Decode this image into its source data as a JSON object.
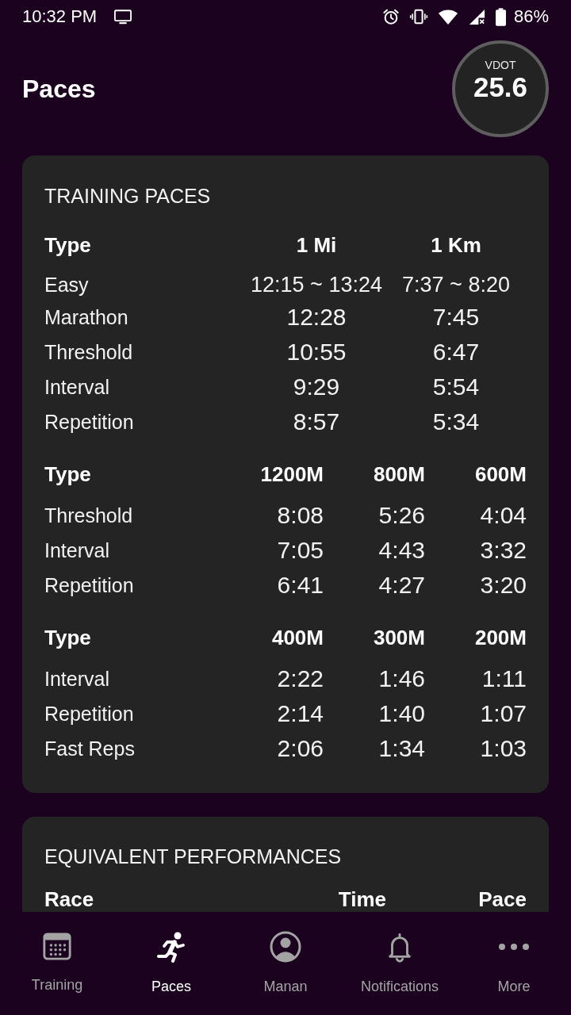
{
  "status_bar": {
    "time": "10:32 PM",
    "battery": "86%"
  },
  "header": {
    "title": "Paces",
    "vdot_label": "VDOT",
    "vdot_value": "25.6"
  },
  "training_paces": {
    "title": "TRAINING PACES",
    "tables": [
      {
        "kind": "distance",
        "columns": [
          "Type",
          "1 Mi",
          "1 Km"
        ],
        "rows": [
          {
            "kind": "range",
            "type": "Easy",
            "values": [
              "12:15 ~ 13:24",
              "7:37 ~ 8:20"
            ]
          },
          {
            "kind": "single",
            "type": "Marathon",
            "values": [
              "12:28",
              "7:45"
            ]
          },
          {
            "kind": "single",
            "type": "Threshold",
            "values": [
              "10:55",
              "6:47"
            ]
          },
          {
            "kind": "single",
            "type": "Interval",
            "values": [
              "9:29",
              "5:54"
            ]
          },
          {
            "kind": "single",
            "type": "Repetition",
            "values": [
              "8:57",
              "5:34"
            ]
          }
        ]
      },
      {
        "kind": "split",
        "columns": [
          "Type",
          "1200M",
          "800M",
          "600M"
        ],
        "rows": [
          {
            "kind": "single",
            "type": "Threshold",
            "values": [
              "8:08",
              "5:26",
              "4:04"
            ]
          },
          {
            "kind": "single",
            "type": "Interval",
            "values": [
              "7:05",
              "4:43",
              "3:32"
            ]
          },
          {
            "kind": "single",
            "type": "Repetition",
            "values": [
              "6:41",
              "4:27",
              "3:20"
            ]
          }
        ]
      },
      {
        "kind": "split",
        "columns": [
          "Type",
          "400M",
          "300M",
          "200M"
        ],
        "rows": [
          {
            "kind": "single",
            "type": "Interval",
            "values": [
              "2:22",
              "1:46",
              "1:11"
            ]
          },
          {
            "kind": "single",
            "type": "Repetition",
            "values": [
              "2:14",
              "1:40",
              "1:07"
            ]
          },
          {
            "kind": "single",
            "type": "Fast Reps",
            "values": [
              "2:06",
              "1:34",
              "1:03"
            ]
          }
        ]
      }
    ]
  },
  "equivalent_performances": {
    "title": "EQUIVALENT PERFORMANCES",
    "columns": [
      "Race",
      "Time",
      "Pace"
    ]
  },
  "bottom_nav": [
    {
      "label": "Training",
      "selected": false
    },
    {
      "label": "Paces",
      "selected": true
    },
    {
      "label": "Manan",
      "selected": false
    },
    {
      "label": "Notifications",
      "selected": false
    },
    {
      "label": "More",
      "selected": false
    }
  ]
}
